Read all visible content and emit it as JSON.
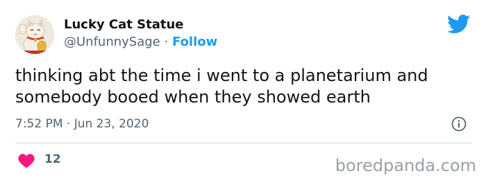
{
  "tweet": {
    "display_name": "Lucky Cat Statue",
    "handle": "@UnfunnySage",
    "separator": "·",
    "follow_label": "Follow",
    "text": "thinking abt the time i went to a planetarium and somebody booed when they showed earth",
    "timestamp": "7:52 PM · Jun 23, 2020",
    "like_count": "12"
  },
  "watermark": "boredpanda.com",
  "icons": {
    "avatar": "lucky-cat-avatar",
    "brand": "twitter-bird-icon",
    "info": "info-icon",
    "like": "heart-icon"
  },
  "colors": {
    "link": "#1d9bf0",
    "heart": "#f91880",
    "muted": "#536471"
  }
}
